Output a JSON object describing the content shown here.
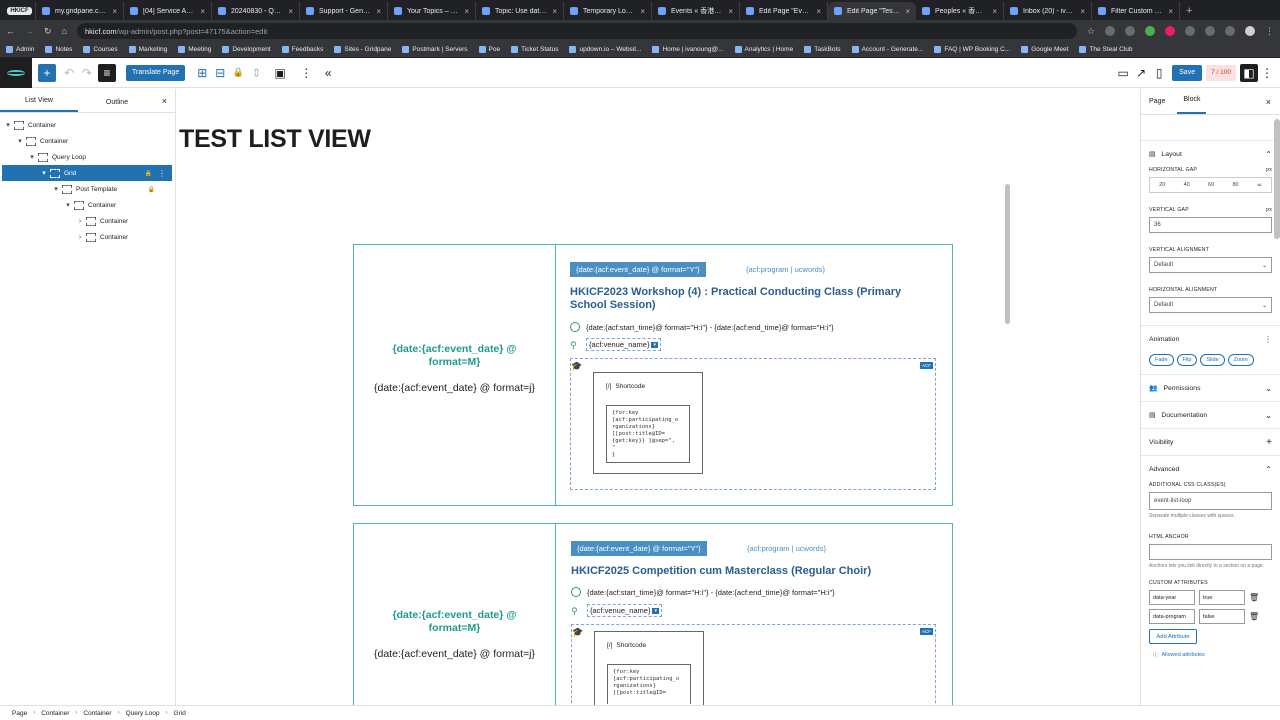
{
  "browser": {
    "pinned_tab": "HKICF",
    "tabs": [
      {
        "title": "my.gridpane.com",
        "active": false
      },
      {
        "title": "[04] Service Agreem...",
        "active": false
      },
      {
        "title": "20240830 - Quotat...",
        "active": false
      },
      {
        "title": "Support - Generate...",
        "active": false
      },
      {
        "title": "Your Topics – Gene...",
        "active": false
      },
      {
        "title": "Topic: Use data attr...",
        "active": false
      },
      {
        "title": "Temporary Logins",
        "active": false
      },
      {
        "title": "Events « 香港校際...",
        "active": false
      },
      {
        "title": "Edit Page \"Events\"",
        "active": false
      },
      {
        "title": "Edit Page \"Test list...",
        "active": true
      },
      {
        "title": "Peoples « 香港校際...",
        "active": false
      },
      {
        "title": "Inbox (20) - ivanou...",
        "active": false
      },
      {
        "title": "Filter Custom Que...",
        "active": false
      }
    ],
    "new_tab": "+",
    "url_host": "hkicf.com",
    "url_path": "/wp-admin/post.php?post=47175&action=edit",
    "bookmarks": [
      "Admin",
      "Notes",
      "Courses",
      "Marketing",
      "Meeting",
      "Development",
      "Feedbacks",
      "Sites - Gridpane",
      "Postmark | Servers",
      "Poe",
      "Ticket Status",
      "updown.io – Websit...",
      "Home | ivanoung@...",
      "Analytics | Home",
      "TaskBots",
      "Account - Generate...",
      "FAQ | WP Booking C...",
      "Google Meet",
      "The Steal Club"
    ]
  },
  "toolbar": {
    "translate_label": "Translate Page",
    "save_label": "Save",
    "seo_score": "7 / 100"
  },
  "left_panel": {
    "tabs": [
      "List View",
      "Outline"
    ],
    "close": "×",
    "tree": [
      {
        "label": "Container",
        "depth": 0,
        "chev": "▾",
        "selected": false,
        "lock": false
      },
      {
        "label": "Container",
        "depth": 1,
        "chev": "▾",
        "selected": false,
        "lock": false
      },
      {
        "label": "Query Loop",
        "depth": 2,
        "chev": "▾",
        "selected": false,
        "lock": false
      },
      {
        "label": "Grid",
        "depth": 3,
        "chev": "▾",
        "selected": true,
        "lock": true
      },
      {
        "label": "Post Template",
        "depth": 4,
        "chev": "▾",
        "selected": false,
        "lock": true
      },
      {
        "label": "Container",
        "depth": 5,
        "chev": "▾",
        "selected": false,
        "lock": false
      },
      {
        "label": "Container",
        "depth": 6,
        "chev": "›",
        "selected": false,
        "lock": false
      },
      {
        "label": "Container",
        "depth": 6,
        "chev": "›",
        "selected": false,
        "lock": false
      }
    ]
  },
  "canvas": {
    "page_title": "TEST LIST VIEW",
    "cards": [
      {
        "month": "{date:{acf:event_date} @ format=M}",
        "day": "{date:{acf:event_date} @ format=j}",
        "date_badge": "{date:{acf:event_date} @ format=\"Y\"}",
        "program": "{acf:program | ucwords}",
        "title": "HKICF2023 Workshop (4) : Practical Conducting Class (Primary School Session)",
        "time": "{date:{acf:start_time}@ format=\"H:i\"} - {date:{acf:end_time}@ format=\"H:i\"}",
        "venue": "{acf:venue_name}",
        "shortcode_label": "Shortcode",
        "shortcode_code": "{for:key\n[acf:participating_o\nrganizations}\n[[post:title@ID=\n{get:key}} ]@sep=\",\n\"\n}"
      },
      {
        "month": "{date:{acf:event_date} @ format=M}",
        "day": "{date:{acf:event_date} @ format=j}",
        "date_badge": "{date:{acf:event_date} @ format=\"Y\"}",
        "program": "{acf:program | ucwords}",
        "title": "HKICF2025 Competition cum Masterclass (Regular Choir)",
        "time": "{date:{acf:start_time}@ format=\"H:i\"} - {date:{acf:end_time}@ format=\"H:i\"}",
        "venue": "{acf:venue_name}",
        "shortcode_label": "Shortcode",
        "shortcode_code": "{for:key\n[acf:participating_o\nrganizations}\n[[post:title@ID="
      }
    ]
  },
  "right_panel": {
    "tabs": [
      "Page",
      "Block"
    ],
    "close": "×",
    "layout": {
      "title": "Layout",
      "horizontal_gap_label": "HORIZONTAL GAP",
      "gap_values": [
        "20",
        "40",
        "60",
        "80"
      ],
      "vertical_gap_label": "VERTICAL GAP",
      "vertical_gap_value": "36",
      "vertical_alignment_label": "VERTICAL ALIGNMENT",
      "vertical_alignment_value": "Default",
      "horizontal_alignment_label": "HORIZONTAL ALIGNMENT",
      "horizontal_alignment_value": "Default",
      "unit": "px"
    },
    "animation": {
      "title": "Animation",
      "options": [
        "Fade",
        "Flip",
        "Slide",
        "Zoom"
      ]
    },
    "permissions_title": "Permissions",
    "documentation_title": "Documentation",
    "visibility_title": "Visibility",
    "advanced": {
      "title": "Advanced",
      "css_label": "ADDITIONAL CSS CLASS(ES)",
      "css_value": "event-list-loop",
      "css_help": "Separate multiple classes with spaces.",
      "anchor_label": "HTML ANCHOR",
      "anchor_help": "Anchors lets you link directly to a section on a page.",
      "custom_label": "CUSTOM ATTRIBUTES",
      "attributes": [
        {
          "name": "data-year",
          "value": "true"
        },
        {
          "name": "data-program",
          "value": "false"
        }
      ],
      "add_label": "Add Attribute",
      "allowed_label": "Allowed attributes"
    }
  },
  "breadcrumb": [
    "Page",
    "Container",
    "Container",
    "Query Loop",
    "Grid"
  ]
}
